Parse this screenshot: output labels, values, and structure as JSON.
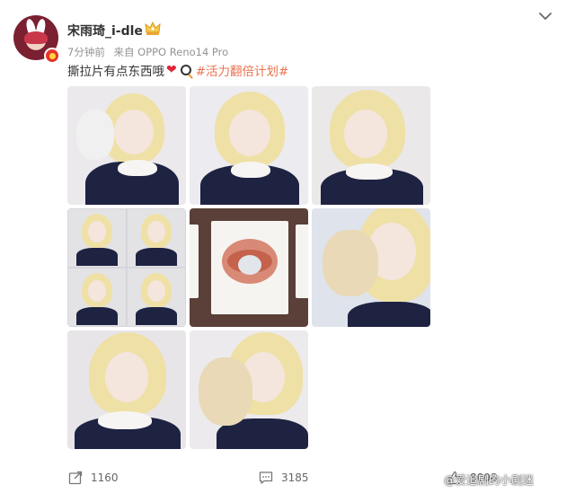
{
  "user": {
    "name": "宋雨琦_i-dle"
  },
  "post": {
    "time": "7分钟前",
    "source": "来自 OPPO Reno14 Pro",
    "text": "撕拉片有点东西哦",
    "hashtag": "#活力翻倍计划#"
  },
  "icons": {
    "more": "chevron-down-icon",
    "vip": "crown-icon",
    "verified": "verified-badge-icon",
    "repost": "repost-icon",
    "comment": "comment-icon",
    "like": "like-icon"
  },
  "stats": {
    "reposts": "1160",
    "comments": "3185",
    "likes": "8008"
  },
  "watermark": "@爱追剧的小剧迷",
  "colors": {
    "hashtag": "#eb7350",
    "text": "#333333",
    "meta": "#939393",
    "heart": "#e0243a"
  }
}
